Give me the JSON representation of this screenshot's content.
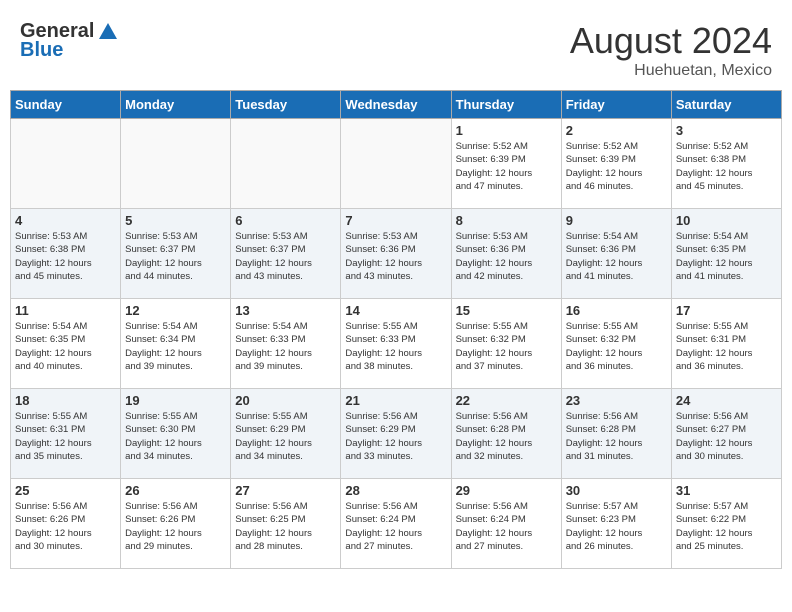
{
  "header": {
    "logo_line1": "General",
    "logo_line2": "Blue",
    "main_title": "August 2024",
    "subtitle": "Huehuetan, Mexico"
  },
  "weekdays": [
    "Sunday",
    "Monday",
    "Tuesday",
    "Wednesday",
    "Thursday",
    "Friday",
    "Saturday"
  ],
  "weeks": [
    [
      {
        "day": "",
        "info": ""
      },
      {
        "day": "",
        "info": ""
      },
      {
        "day": "",
        "info": ""
      },
      {
        "day": "",
        "info": ""
      },
      {
        "day": "1",
        "info": "Sunrise: 5:52 AM\nSunset: 6:39 PM\nDaylight: 12 hours\nand 47 minutes."
      },
      {
        "day": "2",
        "info": "Sunrise: 5:52 AM\nSunset: 6:39 PM\nDaylight: 12 hours\nand 46 minutes."
      },
      {
        "day": "3",
        "info": "Sunrise: 5:52 AM\nSunset: 6:38 PM\nDaylight: 12 hours\nand 45 minutes."
      }
    ],
    [
      {
        "day": "4",
        "info": "Sunrise: 5:53 AM\nSunset: 6:38 PM\nDaylight: 12 hours\nand 45 minutes."
      },
      {
        "day": "5",
        "info": "Sunrise: 5:53 AM\nSunset: 6:37 PM\nDaylight: 12 hours\nand 44 minutes."
      },
      {
        "day": "6",
        "info": "Sunrise: 5:53 AM\nSunset: 6:37 PM\nDaylight: 12 hours\nand 43 minutes."
      },
      {
        "day": "7",
        "info": "Sunrise: 5:53 AM\nSunset: 6:36 PM\nDaylight: 12 hours\nand 43 minutes."
      },
      {
        "day": "8",
        "info": "Sunrise: 5:53 AM\nSunset: 6:36 PM\nDaylight: 12 hours\nand 42 minutes."
      },
      {
        "day": "9",
        "info": "Sunrise: 5:54 AM\nSunset: 6:36 PM\nDaylight: 12 hours\nand 41 minutes."
      },
      {
        "day": "10",
        "info": "Sunrise: 5:54 AM\nSunset: 6:35 PM\nDaylight: 12 hours\nand 41 minutes."
      }
    ],
    [
      {
        "day": "11",
        "info": "Sunrise: 5:54 AM\nSunset: 6:35 PM\nDaylight: 12 hours\nand 40 minutes."
      },
      {
        "day": "12",
        "info": "Sunrise: 5:54 AM\nSunset: 6:34 PM\nDaylight: 12 hours\nand 39 minutes."
      },
      {
        "day": "13",
        "info": "Sunrise: 5:54 AM\nSunset: 6:33 PM\nDaylight: 12 hours\nand 39 minutes."
      },
      {
        "day": "14",
        "info": "Sunrise: 5:55 AM\nSunset: 6:33 PM\nDaylight: 12 hours\nand 38 minutes."
      },
      {
        "day": "15",
        "info": "Sunrise: 5:55 AM\nSunset: 6:32 PM\nDaylight: 12 hours\nand 37 minutes."
      },
      {
        "day": "16",
        "info": "Sunrise: 5:55 AM\nSunset: 6:32 PM\nDaylight: 12 hours\nand 36 minutes."
      },
      {
        "day": "17",
        "info": "Sunrise: 5:55 AM\nSunset: 6:31 PM\nDaylight: 12 hours\nand 36 minutes."
      }
    ],
    [
      {
        "day": "18",
        "info": "Sunrise: 5:55 AM\nSunset: 6:31 PM\nDaylight: 12 hours\nand 35 minutes."
      },
      {
        "day": "19",
        "info": "Sunrise: 5:55 AM\nSunset: 6:30 PM\nDaylight: 12 hours\nand 34 minutes."
      },
      {
        "day": "20",
        "info": "Sunrise: 5:55 AM\nSunset: 6:29 PM\nDaylight: 12 hours\nand 34 minutes."
      },
      {
        "day": "21",
        "info": "Sunrise: 5:56 AM\nSunset: 6:29 PM\nDaylight: 12 hours\nand 33 minutes."
      },
      {
        "day": "22",
        "info": "Sunrise: 5:56 AM\nSunset: 6:28 PM\nDaylight: 12 hours\nand 32 minutes."
      },
      {
        "day": "23",
        "info": "Sunrise: 5:56 AM\nSunset: 6:28 PM\nDaylight: 12 hours\nand 31 minutes."
      },
      {
        "day": "24",
        "info": "Sunrise: 5:56 AM\nSunset: 6:27 PM\nDaylight: 12 hours\nand 30 minutes."
      }
    ],
    [
      {
        "day": "25",
        "info": "Sunrise: 5:56 AM\nSunset: 6:26 PM\nDaylight: 12 hours\nand 30 minutes."
      },
      {
        "day": "26",
        "info": "Sunrise: 5:56 AM\nSunset: 6:26 PM\nDaylight: 12 hours\nand 29 minutes."
      },
      {
        "day": "27",
        "info": "Sunrise: 5:56 AM\nSunset: 6:25 PM\nDaylight: 12 hours\nand 28 minutes."
      },
      {
        "day": "28",
        "info": "Sunrise: 5:56 AM\nSunset: 6:24 PM\nDaylight: 12 hours\nand 27 minutes."
      },
      {
        "day": "29",
        "info": "Sunrise: 5:56 AM\nSunset: 6:24 PM\nDaylight: 12 hours\nand 27 minutes."
      },
      {
        "day": "30",
        "info": "Sunrise: 5:57 AM\nSunset: 6:23 PM\nDaylight: 12 hours\nand 26 minutes."
      },
      {
        "day": "31",
        "info": "Sunrise: 5:57 AM\nSunset: 6:22 PM\nDaylight: 12 hours\nand 25 minutes."
      }
    ]
  ]
}
